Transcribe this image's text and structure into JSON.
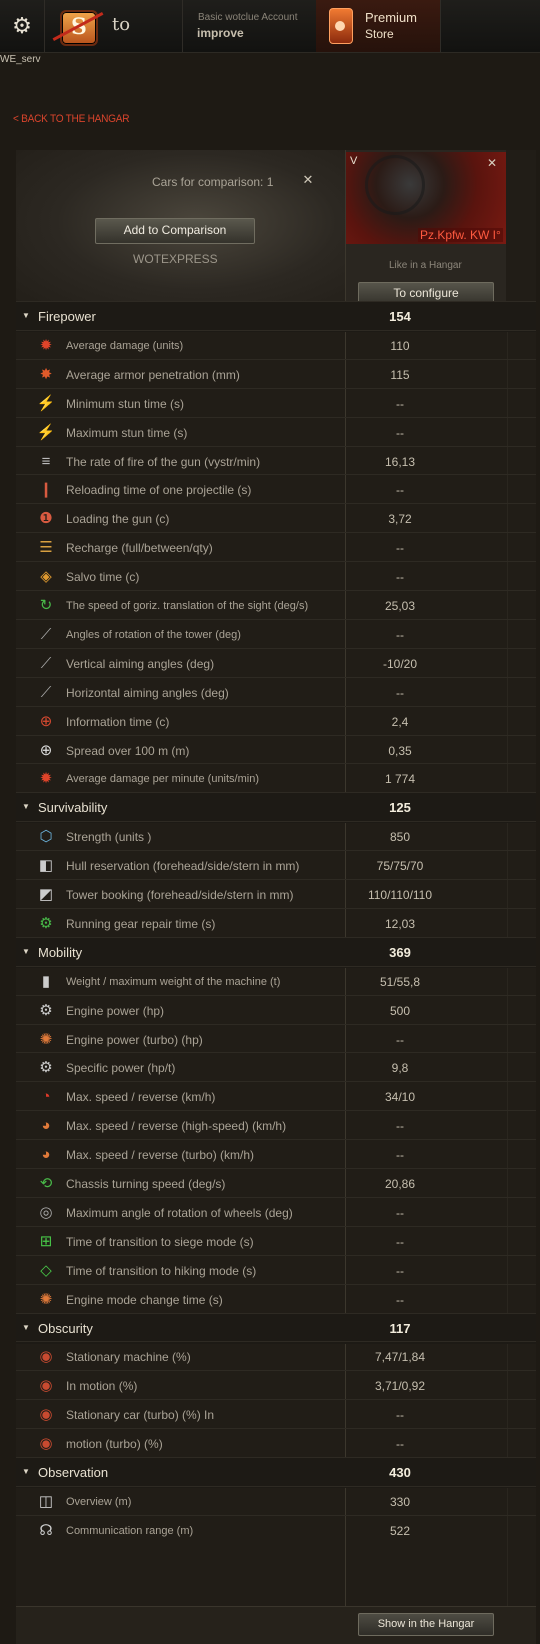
{
  "header": {
    "logo_letter": "S",
    "to_text": "to",
    "account_label": "Basic wotclue Account",
    "account_value": "improve",
    "premium_line1": "Premium",
    "premium_line2": "Store",
    "server": "WE_serv"
  },
  "nav": {
    "back": "< BACK TO THE HANGAR"
  },
  "comparison": {
    "title": "Cars for comparison: 1",
    "close": "✕",
    "add_button": "Add to Comparison",
    "watermark": "WOTEXPRESS"
  },
  "tank": {
    "tier": "V",
    "name": "Pz.Kpfw. KW I°",
    "close": "✕",
    "subtitle": "Like in a Hangar",
    "configure_button": "To configure"
  },
  "sections": [
    {
      "name": "Firepower",
      "score": "154",
      "rows": [
        {
          "label": "Average damage (units)",
          "value": "110",
          "icon": "burst-icon",
          "color": "#e0442a",
          "small": true
        },
        {
          "label": "Average armor penetration (mm)",
          "value": "115",
          "icon": "penetration-icon",
          "color": "#e05a2a",
          "small": false
        },
        {
          "label": "Minimum stun time (s)",
          "value": "--",
          "icon": "stun-icon",
          "color": "#e06a2a",
          "small": false
        },
        {
          "label": "Maximum stun time (s)",
          "value": "--",
          "icon": "stun-icon",
          "color": "#e06a2a",
          "small": false
        },
        {
          "label": "The rate of fire of the gun (vystr/min)",
          "value": "16,13",
          "icon": "rate-of-fire-icon",
          "color": "#bbbbbb",
          "small": false
        },
        {
          "label": "Reloading time of one projectile (s)",
          "value": "--",
          "icon": "shells-icon",
          "color": "#d85a40",
          "small": false
        },
        {
          "label": "Loading the gun (c)",
          "value": "3,72",
          "icon": "shell-reload-icon",
          "color": "#d85a40",
          "small": false
        },
        {
          "label": "Recharge (full/between/qty)",
          "value": "--",
          "icon": "magazine-icon",
          "color": "#d8a040",
          "small": false
        },
        {
          "label": "Salvo time (c)",
          "value": "--",
          "icon": "salvo-icon",
          "color": "#e09a30",
          "small": false
        },
        {
          "label": "The speed of goriz. translation of the sight (deg/s)",
          "value": "25,03",
          "icon": "traverse-icon",
          "color": "#48b848",
          "small": true
        },
        {
          "label": "Angles of rotation of the tower (deg)",
          "value": "--",
          "icon": "turret-icon",
          "color": "#aaaaaa",
          "small": true
        },
        {
          "label": "Vertical aiming angles (deg)",
          "value": "-10/20",
          "icon": "elevation-icon",
          "color": "#aaaaaa",
          "small": false
        },
        {
          "label": "Horizontal aiming angles (deg)",
          "value": "--",
          "icon": "horizontal-aim-icon",
          "color": "#aaaaaa",
          "small": false
        },
        {
          "label": "Information time (c)",
          "value": "2,4",
          "icon": "aim-time-icon",
          "color": "#d84a30",
          "small": false
        },
        {
          "label": "Spread over 100 m (m)",
          "value": "0,35",
          "icon": "crosshair-icon",
          "color": "#dddddd",
          "small": false
        },
        {
          "label": "Average damage per minute (units/min)",
          "value": "1 774",
          "icon": "dpm-icon",
          "color": "#e0442a",
          "small": true
        }
      ]
    },
    {
      "name": "Survivability",
      "score": "125",
      "rows": [
        {
          "label": "Strength (units )",
          "value": "850",
          "icon": "hit-points-icon",
          "color": "#6ab0d8",
          "small": false
        },
        {
          "label": "Hull reservation (forehead/side/stern in mm)",
          "value": "75/75/70",
          "icon": "hull-armor-icon",
          "color": "#cccccc",
          "small": false
        },
        {
          "label": "Tower booking (forehead/side/stern in mm)",
          "value": "110/110/110",
          "icon": "turret-armor-icon",
          "color": "#cccccc",
          "small": false
        },
        {
          "label": "Running gear repair time (s)",
          "value": "12,03",
          "icon": "repair-icon",
          "color": "#48b848",
          "small": false
        }
      ]
    },
    {
      "name": "Mobility",
      "score": "369",
      "rows": [
        {
          "label": "Weight / maximum weight of the machine (t)",
          "value": "51/55,8",
          "icon": "weight-icon",
          "color": "#cccccc",
          "small": true
        },
        {
          "label": "Engine power (hp)",
          "value": "500",
          "icon": "engine-icon",
          "color": "#cccccc",
          "small": false
        },
        {
          "label": "Engine power (turbo) (hp)",
          "value": "--",
          "icon": "turbo-engine-icon",
          "color": "#e07a3a",
          "small": false
        },
        {
          "label": "Specific power (hp/t)",
          "value": "9,8",
          "icon": "specific-power-icon",
          "color": "#cccccc",
          "small": false
        },
        {
          "label": "Max. speed / reverse (km/h)",
          "value": "34/10",
          "icon": "speedometer-icon",
          "color": "#e03a2a",
          "small": false
        },
        {
          "label": "Max. speed / reverse (high-speed) (km/h)",
          "value": "--",
          "icon": "high-speed-icon",
          "color": "#e07a3a",
          "small": false
        },
        {
          "label": "Max. speed / reverse (turbo) (km/h)",
          "value": "--",
          "icon": "turbo-speed-icon",
          "color": "#e07a3a",
          "small": false
        },
        {
          "label": "Chassis turning speed (deg/s)",
          "value": "20,86",
          "icon": "chassis-traverse-icon",
          "color": "#48b848",
          "small": false
        },
        {
          "label": "Maximum angle of rotation of wheels (deg)",
          "value": "--",
          "icon": "wheel-angle-icon",
          "color": "#aaaaaa",
          "small": false
        },
        {
          "label": "Time of transition to siege mode (s)",
          "value": "--",
          "icon": "siege-mode-icon",
          "color": "#48c848",
          "small": false
        },
        {
          "label": "Time of transition to hiking mode (s)",
          "value": "--",
          "icon": "travel-mode-icon",
          "color": "#48c848",
          "small": false
        },
        {
          "label": "Engine mode change time (s)",
          "value": "--",
          "icon": "engine-mode-icon",
          "color": "#e07a3a",
          "small": false
        }
      ]
    },
    {
      "name": "Obscurity",
      "score": "117",
      "rows": [
        {
          "label": "Stationary machine (%)",
          "value": "7,47/1,84",
          "icon": "camo-stationary-icon",
          "color": "#c84a30",
          "small": false
        },
        {
          "label": "In motion (%)",
          "value": "3,71/0,92",
          "icon": "camo-moving-icon",
          "color": "#c84a30",
          "small": false
        },
        {
          "label": "Stationary car (turbo) (%) In",
          "value": "--",
          "icon": "camo-turbo-icon",
          "color": "#c84a30",
          "small": false
        },
        {
          "label": "motion (turbo) (%)",
          "value": "--",
          "icon": "camo-turbo-moving-icon",
          "color": "#c84a30",
          "small": false
        }
      ]
    },
    {
      "name": "Observation",
      "score": "430",
      "rows": [
        {
          "label": "Overview (m)",
          "value": "330",
          "icon": "view-range-icon",
          "color": "#cccccc",
          "small": true
        },
        {
          "label": "Communication range (m)",
          "value": "522",
          "icon": "radio-icon",
          "color": "#cccccc",
          "small": true
        }
      ]
    }
  ],
  "footer": {
    "show_button": "Show in the Hangar"
  }
}
